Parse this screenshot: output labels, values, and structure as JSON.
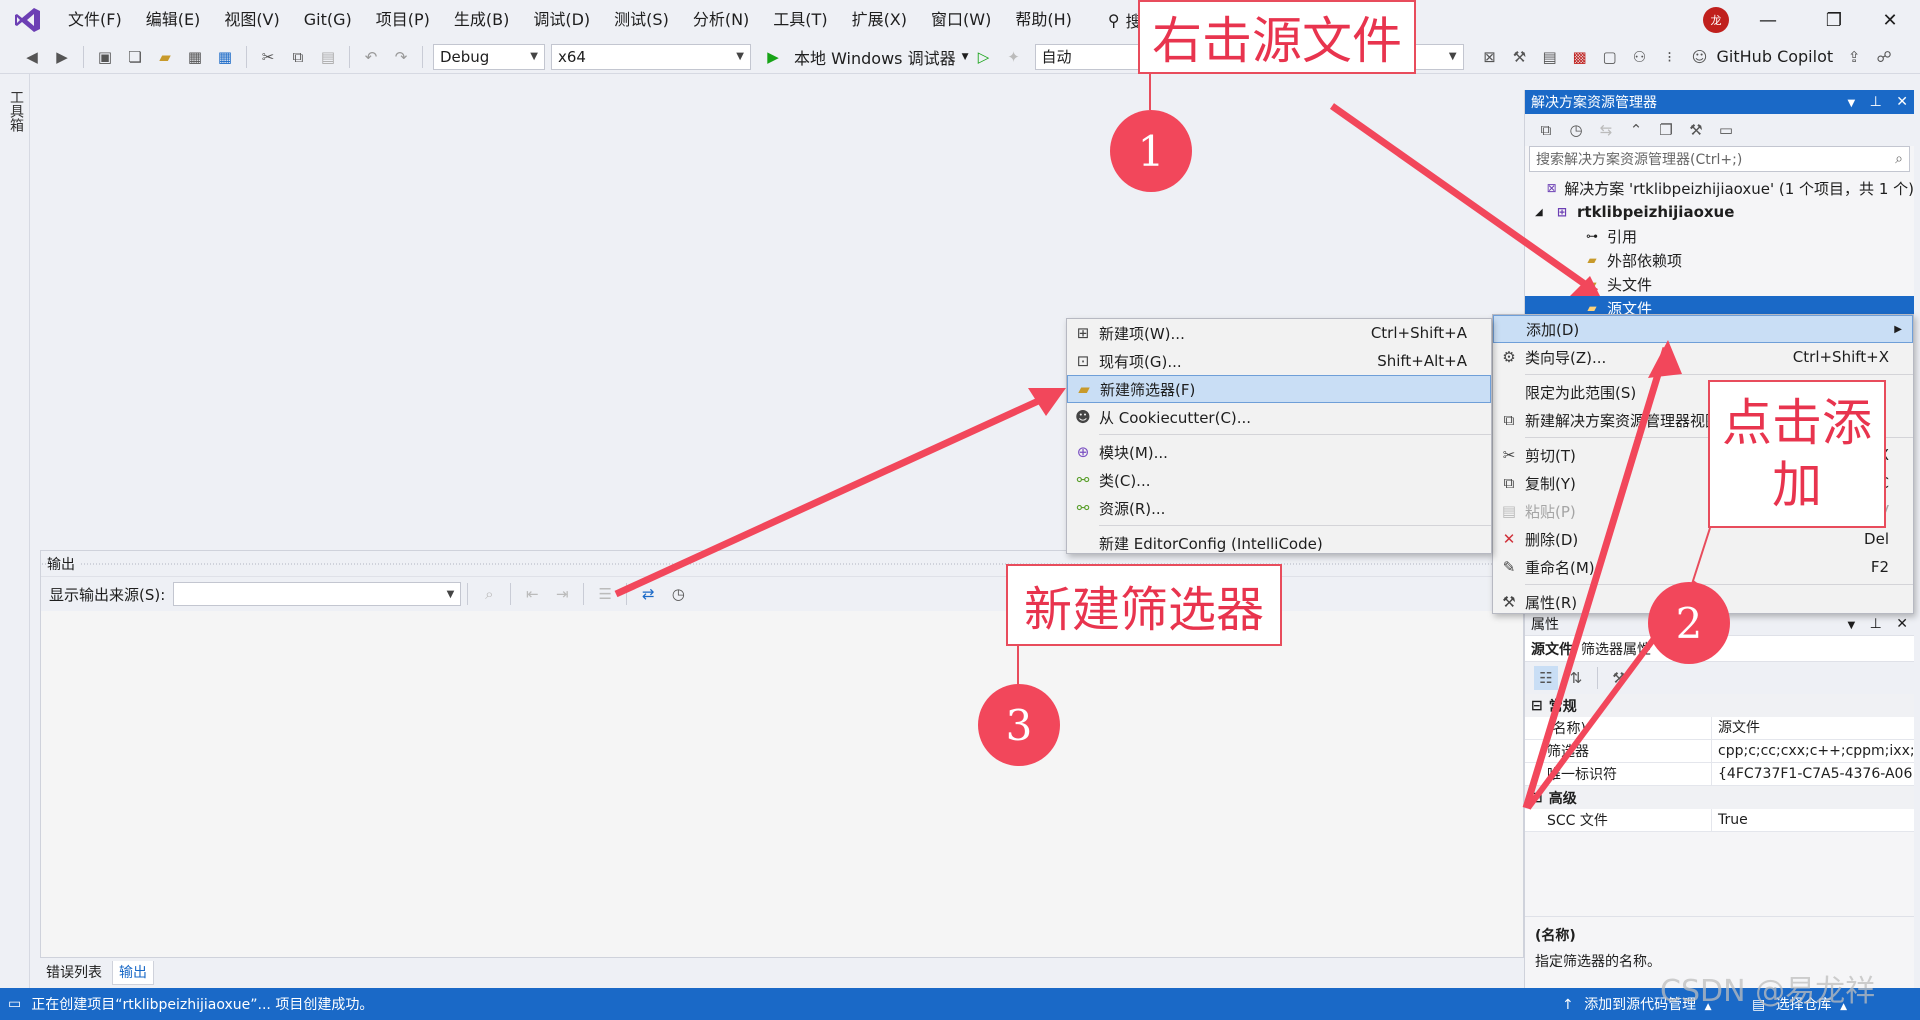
{
  "menubar": {
    "items": [
      "文件(F)",
      "编辑(E)",
      "视图(V)",
      "Git(G)",
      "项目(P)",
      "生成(B)",
      "调试(D)",
      "测试(S)",
      "分析(N)",
      "工具(T)",
      "扩展(X)",
      "窗口(W)",
      "帮助(H)"
    ],
    "search_label": "搜索",
    "solution_title": "rtklibpeizhijiaoxue",
    "avatar_text": "龙"
  },
  "toolbar": {
    "config": "Debug",
    "platform": "x64",
    "run_label": "本地 Windows 调试器",
    "auto_label": "自动",
    "copilot_label": "GitHub Copilot"
  },
  "left_tab": "工具箱",
  "output": {
    "title": "输出",
    "source_label": "显示输出来源(S):",
    "source_value": ""
  },
  "bottom_tabs": [
    "错误列表",
    "输出"
  ],
  "solution_explorer": {
    "title": "解决方案资源管理器",
    "search_placeholder": "搜索解决方案资源管理器(Ctrl+;)",
    "tree": [
      "解决方案 'rtklibpeizhijiaoxue' (1 个项目，共 1 个)",
      "rtklibpeizhijiaoxue",
      "引用",
      "外部依赖项",
      "头文件",
      "源文件"
    ]
  },
  "properties": {
    "title": "属性",
    "selected_name": "源文件",
    "selected_type": "筛选器属性",
    "cat_general": "常规",
    "cat_advanced": "高级",
    "rows": [
      {
        "k": "(名称)",
        "v": "源文件"
      },
      {
        "k": "筛选器",
        "v": "cpp;c;cc;cxx;c++;cppm;ixx;"
      },
      {
        "k": "唯一标识符",
        "v": "{4FC737F1-C7A5-4376-A06"
      }
    ],
    "adv_rows": [
      {
        "k": "SCC 文件",
        "v": "True"
      }
    ],
    "desc_title": "(名称)",
    "desc_text": "指定筛选器的名称。"
  },
  "context_menu_main": [
    {
      "label": "添加(D)",
      "shortcut": "",
      "icon": "none",
      "state": "highlight"
    },
    {
      "label": "类向导(Z)...",
      "shortcut": "Ctrl+Shift+X",
      "icon": "class-wizard-icon",
      "state": ""
    },
    {
      "sep": true
    },
    {
      "label": "限定为此范围(S)",
      "shortcut": "",
      "icon": "none",
      "state": ""
    },
    {
      "label": "新建解决方案资源管理器视图(N)",
      "shortcut": "",
      "icon": "new-view-icon",
      "state": ""
    },
    {
      "sep": true
    },
    {
      "label": "剪切(T)",
      "shortcut": "Ctrl+X",
      "icon": "cut-icon",
      "state": ""
    },
    {
      "label": "复制(Y)",
      "shortcut": "Ctrl+C",
      "icon": "copy-icon",
      "state": ""
    },
    {
      "label": "粘贴(P)",
      "shortcut": "Ctrl+V",
      "icon": "paste-icon",
      "state": "disabled"
    },
    {
      "label": "删除(D)",
      "shortcut": "Del",
      "icon": "delete-icon",
      "state": ""
    },
    {
      "label": "重命名(M)",
      "shortcut": "F2",
      "icon": "rename-icon",
      "state": ""
    },
    {
      "sep": true
    },
    {
      "label": "属性(R)",
      "shortcut": "",
      "icon": "wrench-icon",
      "state": ""
    }
  ],
  "context_menu_add": [
    {
      "label": "新建项(W)...",
      "shortcut": "Ctrl+Shift+A",
      "icon": "new-item-icon",
      "state": ""
    },
    {
      "label": "现有项(G)...",
      "shortcut": "Shift+Alt+A",
      "icon": "existing-item-icon",
      "state": ""
    },
    {
      "label": "新建筛选器(F)",
      "shortcut": "",
      "icon": "folder-icon",
      "state": "highlight"
    },
    {
      "label": "从 Cookiecutter(C)...",
      "shortcut": "",
      "icon": "cookie-icon",
      "state": ""
    },
    {
      "sep": true
    },
    {
      "label": "模块(M)...",
      "shortcut": "",
      "icon": "module-icon",
      "state": ""
    },
    {
      "label": "类(C)...",
      "shortcut": "",
      "icon": "class-icon",
      "state": ""
    },
    {
      "label": "资源(R)...",
      "shortcut": "",
      "icon": "resource-icon",
      "state": ""
    },
    {
      "sep": true
    },
    {
      "label": "新建 EditorConfig (IntelliCode)",
      "shortcut": "",
      "icon": "none",
      "state": ""
    }
  ],
  "annotations": {
    "callout1": "右击源文件",
    "callout2": "点击添加",
    "callout3": "新建筛选器",
    "circle1": "1",
    "circle2": "2",
    "circle3": "3"
  },
  "statusbar": {
    "message": "正在创建项目“rtklibpeizhijiaoxue”... 项目创建成功。",
    "source_control": "添加到源代码管理",
    "repo": "选择仓库"
  },
  "watermark": "CSDN @易龙祥",
  "colors": {
    "accent": "#1a69c7",
    "annotation": "#f2475b",
    "vs_purple": "#6c3fb4"
  }
}
